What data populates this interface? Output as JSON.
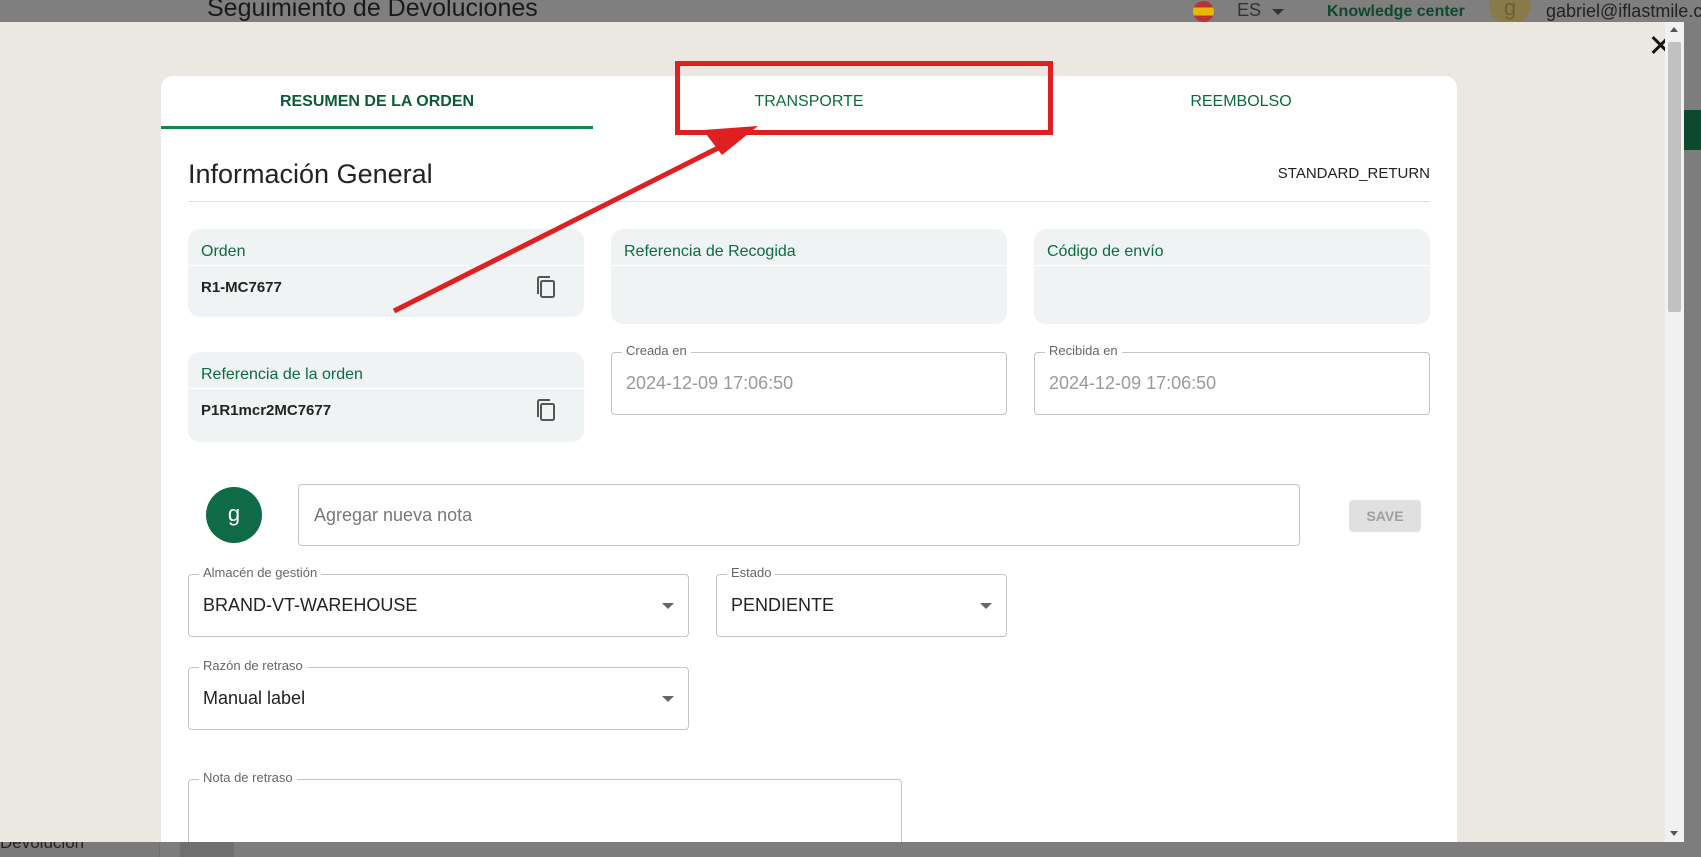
{
  "background": {
    "title": "Seguimiento de Devoluciones",
    "language": "ES",
    "knowledge_center": "Knowledge center",
    "avatar_initial": "g",
    "email": "gabriel@iflastmile.c",
    "bottom_text": "Devolución"
  },
  "tabs": [
    {
      "label": "RESUMEN DE LA ORDEN",
      "active": true
    },
    {
      "label": "TRANSPORTE",
      "active": false
    },
    {
      "label": "REEMBOLSO",
      "active": false
    }
  ],
  "section": {
    "title": "Información General",
    "badge": "STANDARD_RETURN"
  },
  "fields": {
    "orden": {
      "label": "Orden",
      "value": "R1-MC7677"
    },
    "referencia_recogida": {
      "label": "Referencia de Recogida",
      "value": ""
    },
    "codigo_envio": {
      "label": "Código de envío",
      "value": ""
    },
    "referencia_orden": {
      "label": "Referencia de la orden",
      "value": "P1R1mcr2MC7677"
    },
    "creada_en": {
      "label": "Creada en",
      "value": "2024-12-09 17:06:50"
    },
    "recibida_en": {
      "label": "Recibida en",
      "value": "2024-12-09 17:06:50"
    }
  },
  "note": {
    "avatar_initial": "g",
    "placeholder": "Agregar nueva nota",
    "save_label": "SAVE"
  },
  "selects": {
    "almacen": {
      "label": "Almacén de gestión",
      "value": "BRAND-VT-WAREHOUSE"
    },
    "estado": {
      "label": "Estado",
      "value": "PENDIENTE"
    },
    "razon_retraso": {
      "label": "Razón de retraso",
      "value": "Manual label"
    }
  },
  "nota_retraso": {
    "label": "Nota de retraso",
    "value": ""
  },
  "colors": {
    "accent_green": "#0b6b3e",
    "annotation_red": "#e02020",
    "avatar_green": "#0f6b47"
  }
}
